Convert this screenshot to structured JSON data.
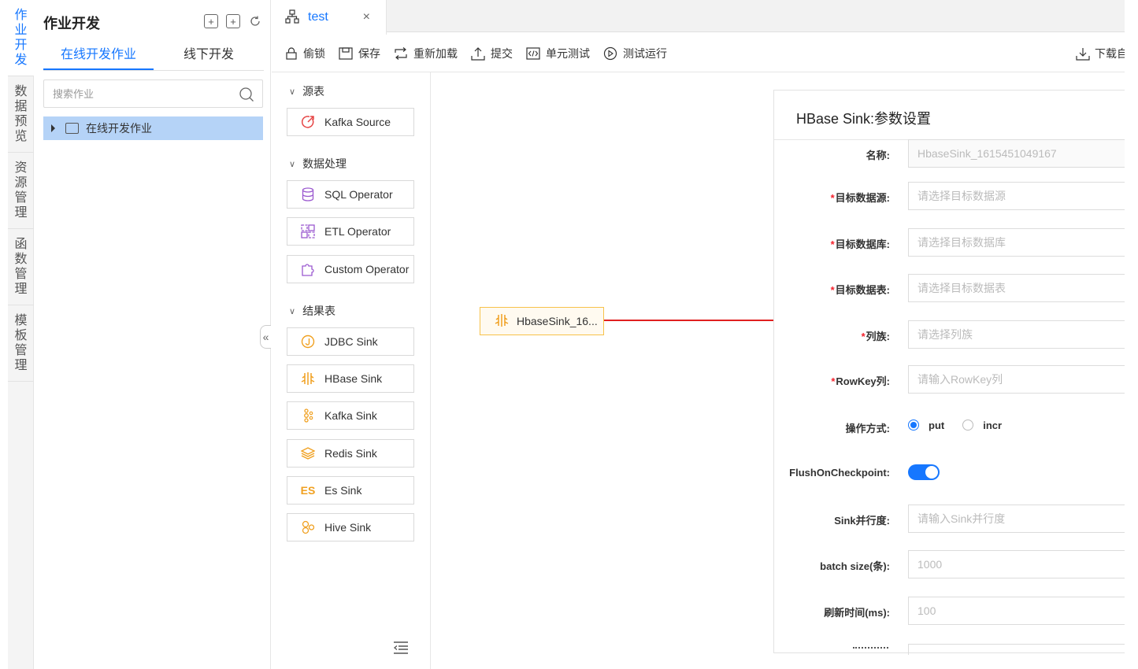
{
  "vertical_nav": [
    {
      "label": "作业开发",
      "active": true
    },
    {
      "label": "数据预览",
      "active": false
    },
    {
      "label": "资源管理",
      "active": false
    },
    {
      "label": "函数管理",
      "active": false
    },
    {
      "label": "模板管理",
      "active": false
    }
  ],
  "job_panel": {
    "title": "作业开发",
    "tabs": [
      "在线开发作业",
      "线下开发"
    ],
    "active_tab": 0,
    "search_placeholder": "搜索作业",
    "tree_item": "在线开发作业",
    "collapse_glyph": "«"
  },
  "editor_tab": {
    "label": "test",
    "close": "×"
  },
  "toolbar": {
    "lock": "偷锁",
    "save": "保存",
    "reload": "重新加载",
    "submit": "提交",
    "unit_test": "单元测试",
    "test_run": "测试运行",
    "download": "下载自"
  },
  "palette": {
    "source_category": "源表",
    "process_category": "数据处理",
    "sink_category": "结果表",
    "sources": [
      {
        "label": "Kafka Source",
        "icon": "kafka-source-icon"
      }
    ],
    "processors": [
      {
        "label": "SQL Operator",
        "icon": "database-icon"
      },
      {
        "label": "ETL Operator",
        "icon": "etl-icon"
      },
      {
        "label": "Custom Operator",
        "icon": "puzzle-icon"
      }
    ],
    "sinks": [
      {
        "label": "JDBC Sink",
        "icon": "jdbc-icon"
      },
      {
        "label": "HBase Sink",
        "icon": "hbase-icon"
      },
      {
        "label": "Kafka Sink",
        "icon": "kafka-icon"
      },
      {
        "label": "Redis Sink",
        "icon": "redis-icon"
      },
      {
        "label": "Es Sink",
        "icon": "es-icon"
      },
      {
        "label": "Hive Sink",
        "icon": "hive-icon"
      }
    ],
    "es_icon_text": "ES"
  },
  "canvas": {
    "node_label": "HbaseSink_16...",
    "arrow_color": "#e02020"
  },
  "settings": {
    "title": "HBase Sink:参数设置",
    "fields": {
      "name": {
        "label": "名称:",
        "value": "HbaseSink_1615451049167"
      },
      "target_source": {
        "label": "目标数据源:",
        "placeholder": "请选择目标数据源",
        "required": true
      },
      "target_db": {
        "label": "目标数据库:",
        "placeholder": "请选择目标数据库",
        "required": true
      },
      "target_table": {
        "label": "目标数据表:",
        "placeholder": "请选择目标数据表",
        "required": true
      },
      "column_family": {
        "label": "列族:",
        "placeholder": "请选择列族",
        "required": true
      },
      "rowkey": {
        "label": "RowKey列:",
        "placeholder": "请输入RowKey列",
        "required": true
      },
      "operation": {
        "label": "操作方式:",
        "options": [
          "put",
          "incr"
        ],
        "selected": "put"
      },
      "flush": {
        "label": "FlushOnCheckpoint:",
        "enabled": true
      },
      "parallelism": {
        "label": "Sink并行度:",
        "placeholder": "请输入Sink并行度"
      },
      "batch_size": {
        "label": "batch size(条):",
        "placeholder": "1000"
      },
      "flush_interval": {
        "label": "刷新时间(ms):",
        "placeholder": "100"
      }
    },
    "required_mark": "*"
  },
  "colors": {
    "accent": "#1677ff",
    "required": "#f5222d",
    "node_border": "#f7c24a",
    "icon_orange": "#f0a020"
  }
}
